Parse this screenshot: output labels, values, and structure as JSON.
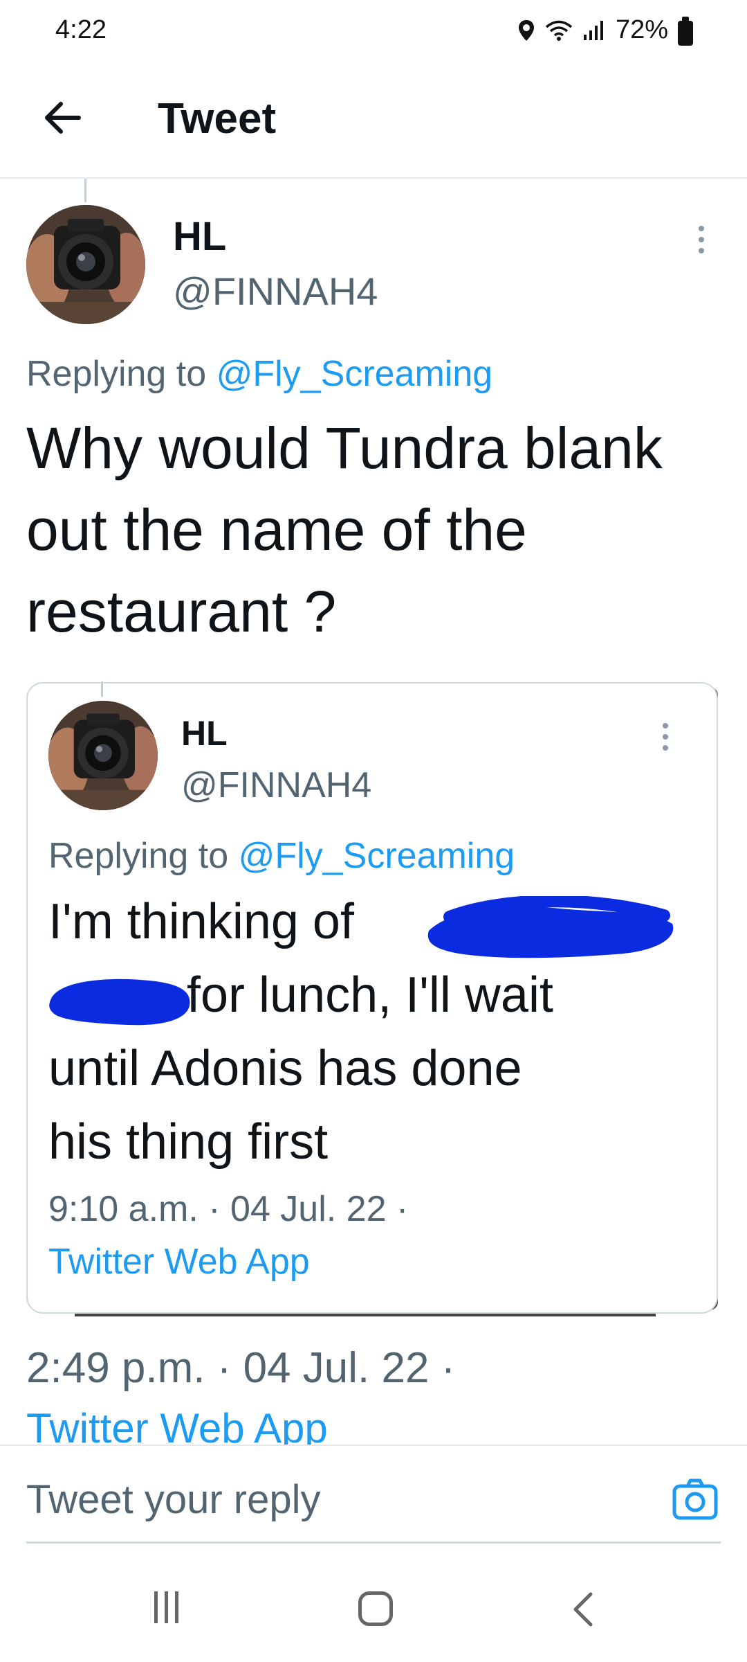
{
  "status_bar": {
    "time": "4:22",
    "battery": "72%",
    "icons": [
      "location-icon",
      "wifi-icon",
      "signal-icon",
      "battery-icon"
    ]
  },
  "header": {
    "title": "Tweet",
    "back_icon": "arrow-left-icon"
  },
  "tweet": {
    "author_name": "HL",
    "author_handle": "@FINNAH4",
    "reply_prefix": "Replying to ",
    "reply_to": "@Fly_Screaming",
    "text": "Why would Tundra blank out the name of the restaurant ?",
    "time": "2:49 p.m. · 04 Jul. 22 ·",
    "source": "Twitter Web App"
  },
  "quoted_tweet": {
    "author_name": "HL",
    "author_handle": "@FINNAH4",
    "reply_prefix": "Replying to ",
    "reply_to": "@Fly_Screaming",
    "text_line1": "I'm thinking of",
    "text_line2": "for lunch, I'll wait",
    "text_line3": "until Adonis has done",
    "text_line4": "his thing first",
    "time": "9:10 a.m. · 04 Jul. 22 ·",
    "source": "Twitter Web App"
  },
  "reply_box": {
    "placeholder": "Tweet your reply",
    "camera_icon": "camera-icon"
  },
  "nav_bar": {
    "icons": [
      "recent-apps-icon",
      "home-icon",
      "back-icon"
    ]
  },
  "colors": {
    "link": "#1d9bf0",
    "secondary_text": "#536471",
    "primary_text": "#0f1419",
    "scribble": "#0a2be0"
  }
}
